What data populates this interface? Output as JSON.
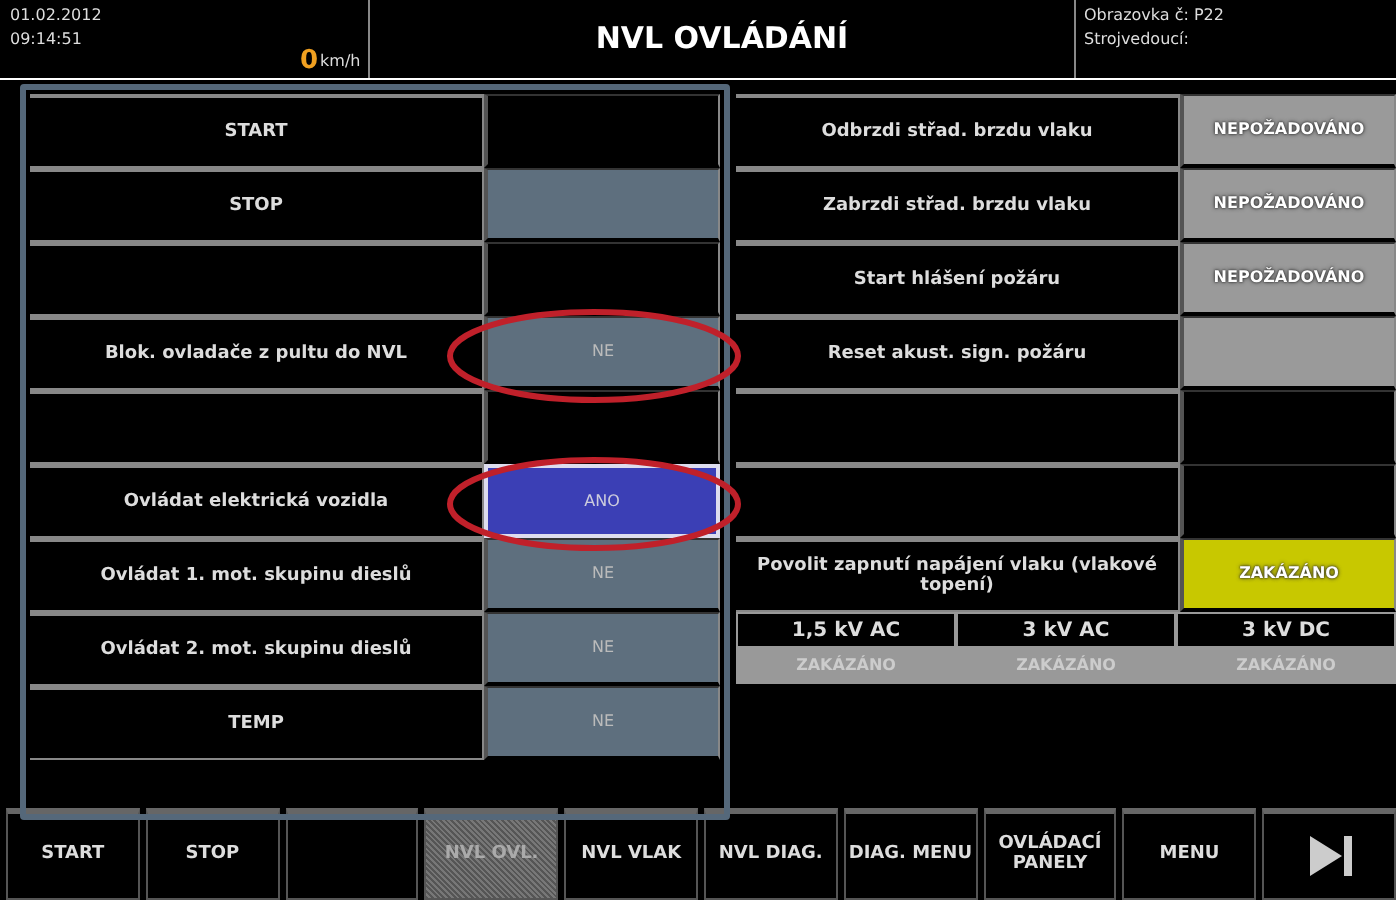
{
  "header": {
    "date": "01.02.2012",
    "time": "09:14:51",
    "speed": "0",
    "speed_unit": "km/h",
    "title": "NVL OVLÁDÁNÍ",
    "screen": "Obrazovka č: P22",
    "driver": "Strojvedoucí:"
  },
  "left_rows": [
    {
      "label": "START",
      "color": "#000000",
      "circled": false
    },
    {
      "label": "STOP",
      "color": "#5e6f7e",
      "circled": false
    },
    {
      "color": "#000000",
      "circled": false
    },
    {
      "label": "Blok. ovladače z pultu do NVL",
      "value": "NE",
      "color": "#5e6f7e",
      "circled": true
    },
    {
      "color": "#000000",
      "circled": false
    },
    {
      "label": "Ovládat elektrická vozidla",
      "value": "ANO",
      "color": "#3b3fb5",
      "circled": true
    },
    {
      "label": "Ovládat 1. mot. skupinu dieslů",
      "value": "NE",
      "color": "#5e6f7e",
      "circled": false
    },
    {
      "label": "Ovládat 2. mot. skupinu dieslů",
      "value": "NE",
      "color": "#5e6f7e",
      "circled": false
    },
    {
      "label": "TEMP",
      "value": "NE",
      "color": "#5e6f7e",
      "circled": false
    }
  ],
  "right_rows": [
    {
      "label": "Odbrzdi střad. brzdu vlaku",
      "value": "NEPOŽADOVÁNO",
      "color": "#9a9a9a"
    },
    {
      "label": "Zabrzdi střad. brzdu vlaku",
      "value": "NEPOŽADOVÁNO",
      "color": "#9a9a9a"
    },
    {
      "label": "Start hlášení požáru",
      "value": "NEPOŽADOVÁNO",
      "color": "#9a9a9a"
    },
    {
      "label": "Reset akust. sign. požáru",
      "color": "#9a9a9a"
    },
    {
      "color": "#000000"
    },
    {
      "color": "#000000"
    },
    {
      "label": "Povolit zapnutí napájení vlaku (vlakové topení)",
      "value": "ZAKÁZÁNO",
      "color": "#c8c800"
    }
  ],
  "voltages": [
    {
      "label": "1,5 kV AC",
      "value": "ZAKÁZÁNO"
    },
    {
      "label": "3 kV AC",
      "value": "ZAKÁZÁNO"
    },
    {
      "label": "3 kV DC",
      "value": "ZAKÁZÁNO"
    }
  ],
  "bottom_buttons": [
    {
      "label": "START",
      "selected": false
    },
    {
      "label": "STOP",
      "selected": false
    },
    {
      "selected": false
    },
    {
      "label": "NVL OVL.",
      "selected": true
    },
    {
      "label": "NVL VLAK",
      "selected": false
    },
    {
      "label": "NVL DIAG.",
      "selected": false
    },
    {
      "label": "DIAG. MENU",
      "selected": false
    },
    {
      "label": "OVLÁDACÍ PANELY",
      "selected": false
    },
    {
      "label": "MENU",
      "selected": false
    },
    {
      "kind": "next",
      "selected": false
    }
  ]
}
